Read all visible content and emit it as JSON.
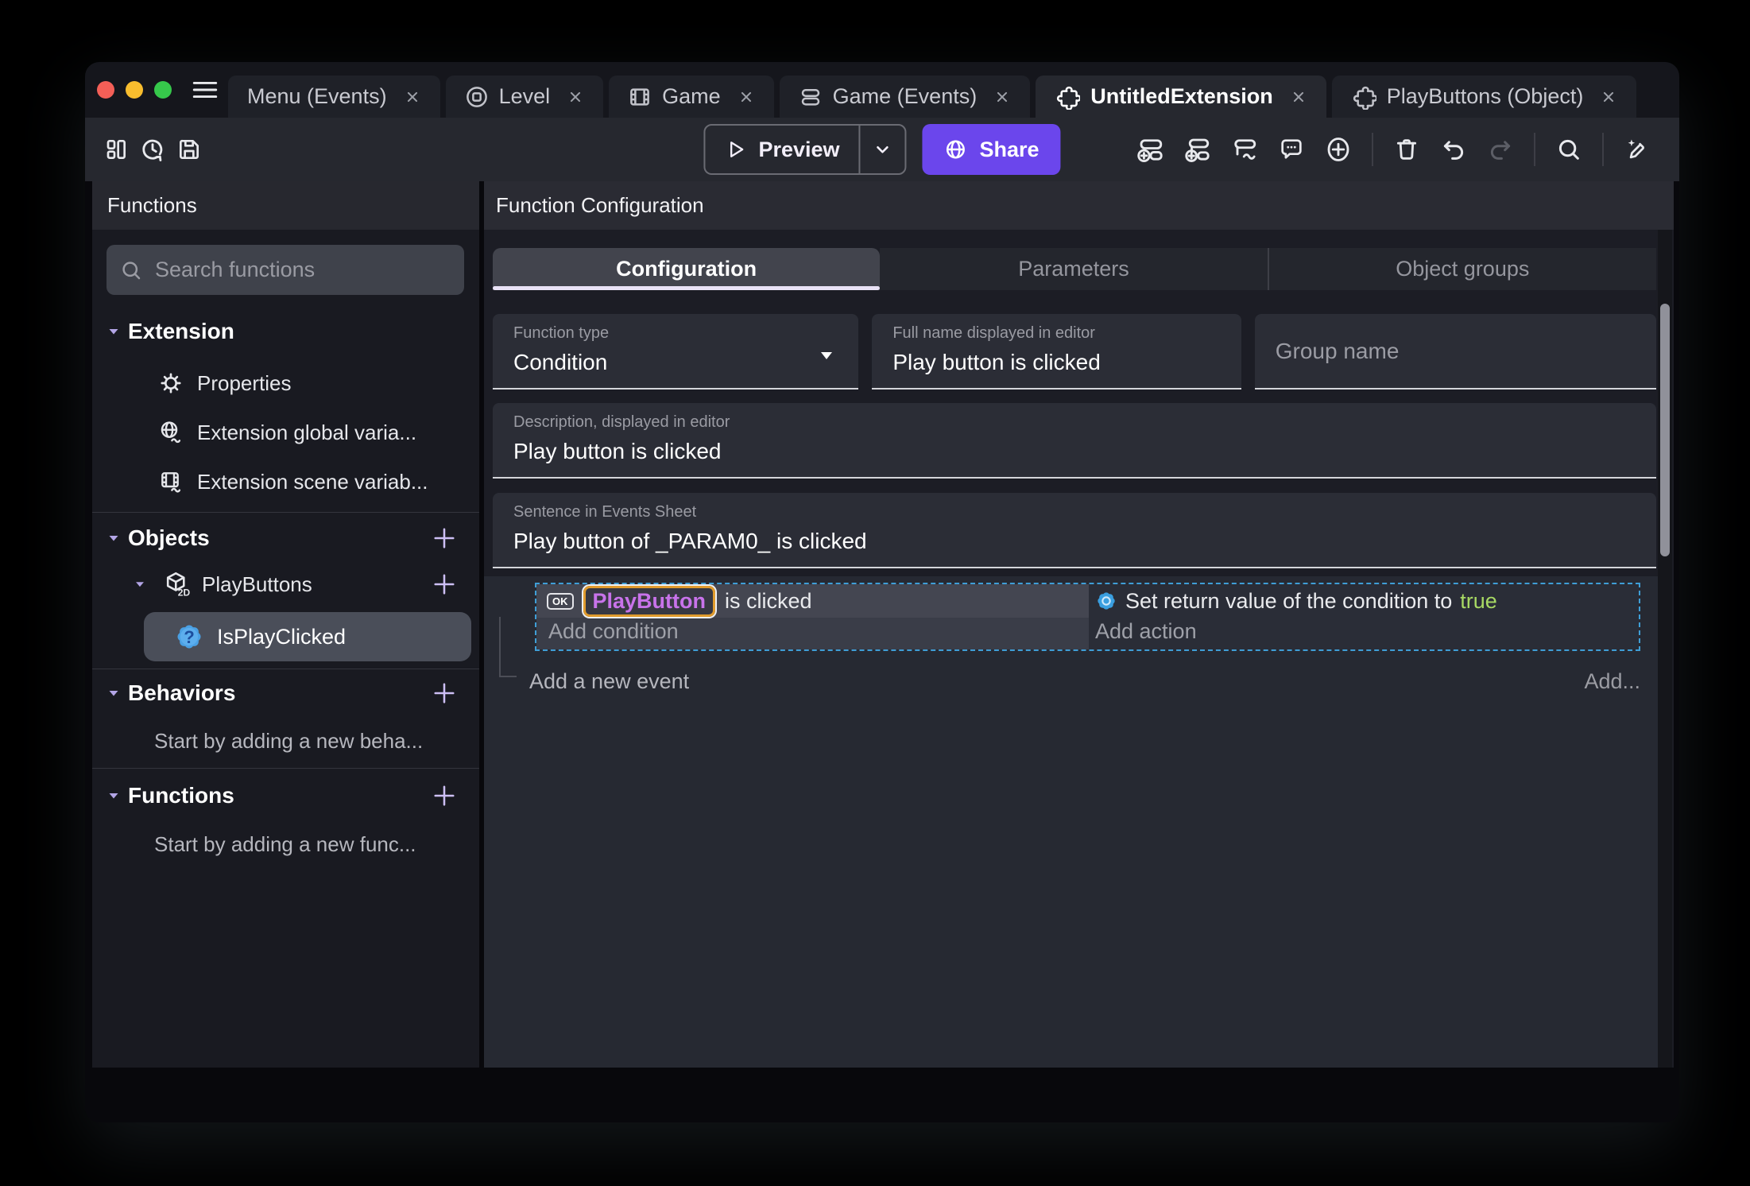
{
  "colors": {
    "accent_purple": "#6b46ec",
    "selection_orange": "#e09b2d",
    "object_pill_text": "#c873ea",
    "boolean_true_green": "#a8d964",
    "event_selection_dashed": "#3f9ed6",
    "traffic_red": "#f35f57",
    "traffic_yellow": "#f8bd2e",
    "traffic_green": "#36c84b"
  },
  "tabbar": {
    "tabs": [
      {
        "label": "Menu (Events)",
        "icon": "none"
      },
      {
        "label": "Level",
        "icon": "level"
      },
      {
        "label": "Game",
        "icon": "film"
      },
      {
        "label": "Game (Events)",
        "icon": "rows"
      },
      {
        "label": "UntitledExtension",
        "icon": "puzzle"
      },
      {
        "label": "PlayButtons (Object)",
        "icon": "puzzle"
      }
    ]
  },
  "toolbar": {
    "left_icons": [
      "project-manager",
      "history",
      "save"
    ],
    "preview": "Preview",
    "share": "Share",
    "right_icons": [
      "add-event",
      "add-subevent",
      "add-condition-row",
      "add-comment",
      "add-circle",
      "trash",
      "undo",
      "redo",
      "search",
      "magic-edit"
    ]
  },
  "sidebar": {
    "title": "Functions",
    "search_placeholder": "Search functions",
    "extension": {
      "label": "Extension",
      "items": [
        "Properties",
        "Extension global varia...",
        "Extension scene variab..."
      ]
    },
    "objects": {
      "label": "Objects",
      "object": "PlayButtons",
      "function": "IsPlayClicked"
    },
    "behaviors": {
      "label": "Behaviors",
      "empty": "Start by adding a new beha..."
    },
    "functions": {
      "label": "Functions",
      "empty": "Start by adding a new func..."
    }
  },
  "main": {
    "title": "Function Configuration",
    "tabs": {
      "configuration": "Configuration",
      "parameters": "Parameters",
      "object_groups": "Object groups"
    },
    "fields": {
      "function_type": {
        "label": "Function type",
        "value": "Condition"
      },
      "full_name": {
        "label": "Full name displayed in editor",
        "value": "Play button is clicked"
      },
      "group_name": {
        "placeholder": "Group name"
      },
      "description": {
        "label": "Description, displayed in editor",
        "value": "Play button is clicked"
      },
      "sentence": {
        "label": "Sentence in Events Sheet",
        "value": "Play button of _PARAM0_ is clicked"
      }
    },
    "events": {
      "ok_badge": "OK",
      "condition_object": "PlayButton",
      "condition_text": "is clicked",
      "add_condition": "Add condition",
      "action_text": "Set return value of the condition to",
      "action_value": "true",
      "add_action": "Add action",
      "add_new_event": "Add a new event",
      "add_more": "Add..."
    }
  }
}
